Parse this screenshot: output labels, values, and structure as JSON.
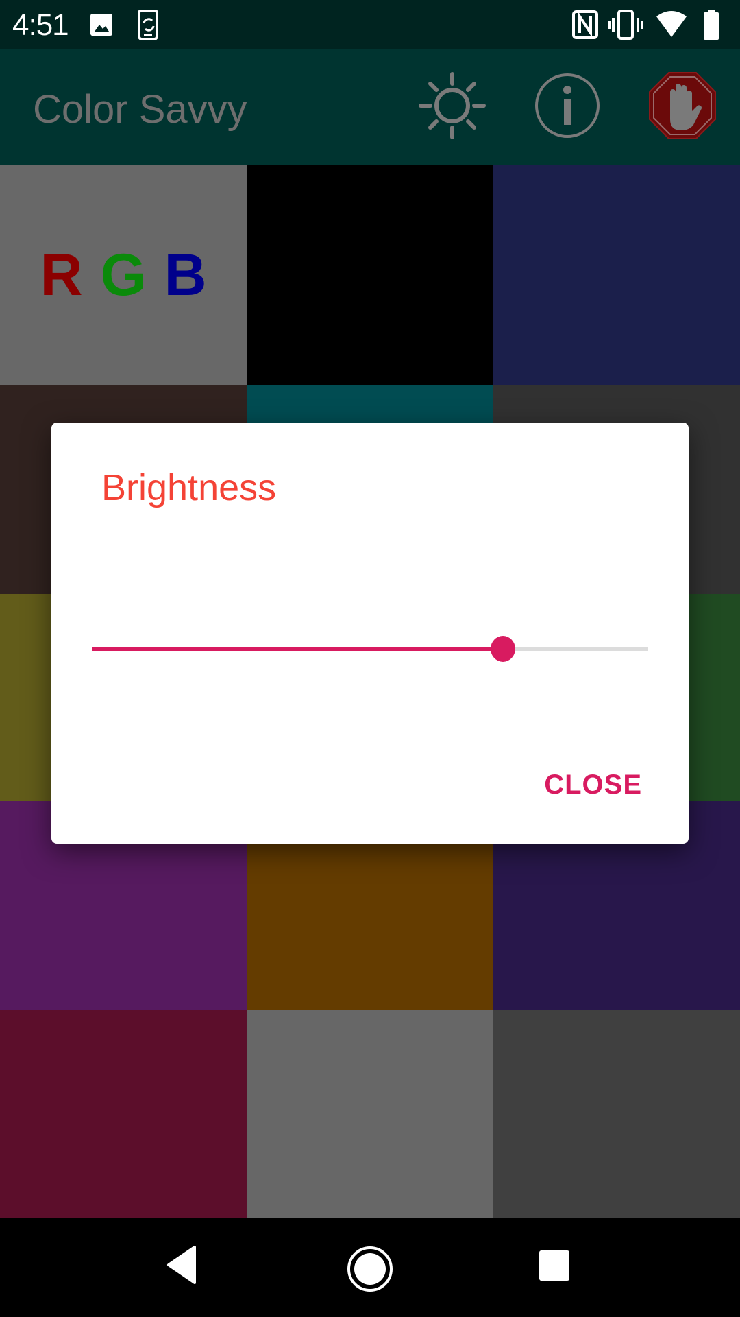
{
  "status_bar": {
    "time": "4:51",
    "left_icons": [
      "image-icon",
      "screen-rotation-icon"
    ],
    "right_icons": [
      "nfc-icon",
      "vibrate-icon",
      "wifi-icon",
      "battery-icon"
    ]
  },
  "app_bar": {
    "title": "Color Savvy",
    "actions": [
      {
        "name": "brightness-icon",
        "label": "Brightness"
      },
      {
        "name": "info-icon",
        "label": "Info"
      },
      {
        "name": "stop-hand-icon",
        "label": "Stop"
      }
    ]
  },
  "rgb_tile": {
    "r": "R",
    "g": "G",
    "b": "B",
    "r_color": "#8b0000",
    "g_color": "#0a8a0a",
    "b_color": "#00008b"
  },
  "color_grid": [
    [
      "#686868",
      "#000000",
      "#1b1f4b"
    ],
    [
      "#30221f",
      "#014c52",
      "#313131"
    ],
    [
      "#625c1a",
      "#ffffff",
      "#204b22"
    ],
    [
      "#561a5f",
      "#643c00",
      "#28174b"
    ],
    [
      "#5c0e2b",
      "#676767",
      "#404040"
    ]
  ],
  "dialog": {
    "title": "Brightness",
    "slider_value_fraction": 0.74,
    "close_label": "CLOSE",
    "accent_color": "#d81b60",
    "title_color": "#f44336"
  },
  "nav_bar": {
    "buttons": [
      "back-icon",
      "home-icon",
      "recents-icon"
    ]
  }
}
